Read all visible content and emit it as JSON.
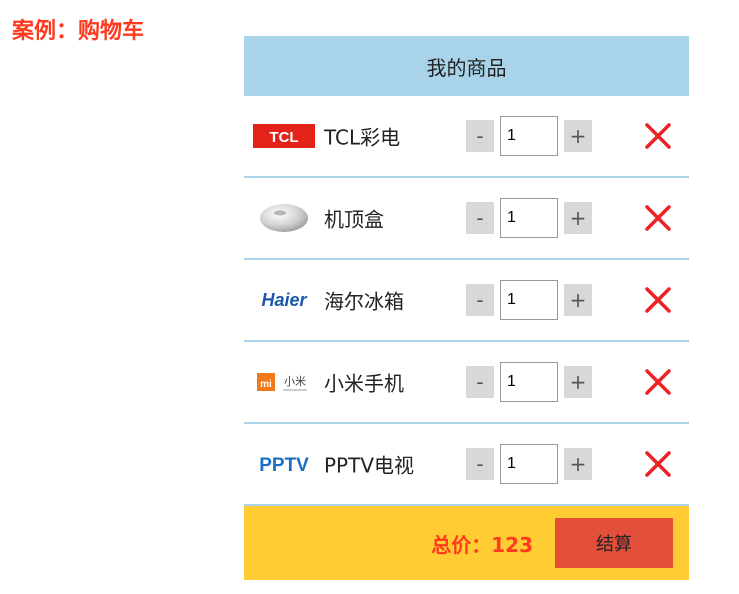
{
  "page": {
    "title": "案例：购物车"
  },
  "cart": {
    "header": "我的商品",
    "items": [
      {
        "name": "TCL彩电",
        "logo_text": "TCL",
        "quantity": "1",
        "minus": "-",
        "plus": "+"
      },
      {
        "name": "机顶盒",
        "logo_text": "",
        "quantity": "1",
        "minus": "-",
        "plus": "+"
      },
      {
        "name": "海尔冰箱",
        "logo_text": "Haier",
        "quantity": "1",
        "minus": "-",
        "plus": "+"
      },
      {
        "name": "小米手机",
        "logo_text": "mi 小米",
        "quantity": "1",
        "minus": "-",
        "plus": "+"
      },
      {
        "name": "PPTV电视",
        "logo_text": "PPTV",
        "quantity": "1",
        "minus": "-",
        "plus": "+"
      }
    ],
    "footer": {
      "total_label": "总价：123",
      "checkout_label": "结算"
    }
  },
  "colors": {
    "title_red": "#ff3a1f",
    "header_blue": "#a9d3e8",
    "footer_yellow": "#ffcc33",
    "checkout_red": "#e34f3b",
    "remove_red": "#ee2222"
  }
}
